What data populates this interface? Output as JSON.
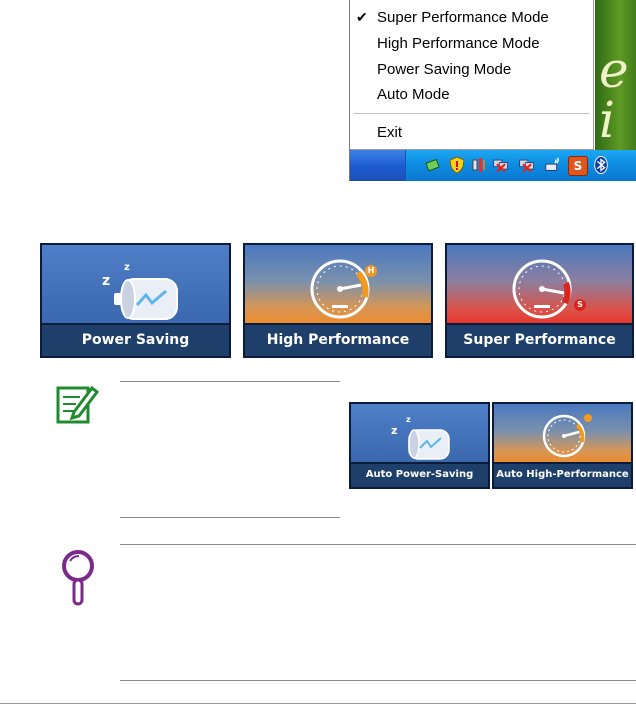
{
  "context_menu": {
    "items": [
      {
        "label": "Super Performance Mode",
        "checked": true
      },
      {
        "label": "High Performance Mode",
        "checked": false
      },
      {
        "label": "Power Saving Mode",
        "checked": false
      },
      {
        "label": "Auto Mode",
        "checked": false
      }
    ],
    "exit_label": "Exit",
    "check_glyph": "✔"
  },
  "tray_icons": [
    "network-icon",
    "security-shield-icon",
    "speaker-icon",
    "network-disconnected-icon",
    "network-disconnected-icon",
    "wireless-icon",
    "super-hybrid-engine-icon",
    "bluetooth-icon"
  ],
  "tray_badge": "S",
  "modes": [
    {
      "caption": "Power Saving",
      "icon": "battery-sleep-icon"
    },
    {
      "caption": "High Performance",
      "icon": "speedometer-icon",
      "badge": "H"
    },
    {
      "caption": "Super Performance",
      "icon": "speedometer-icon",
      "badge": "S"
    }
  ],
  "auto_modes": [
    {
      "caption": "Auto Power-Saving",
      "icon": "battery-sleep-icon"
    },
    {
      "caption": "Auto High-Performance",
      "icon": "speedometer-icon"
    }
  ],
  "sleep_glyph": "z",
  "colors": {
    "note_green": "#1f8a2e",
    "tip_purple": "#7a2a88",
    "caption_blue": "#1d3f6a",
    "high_accent": "#f39a1e",
    "super_accent": "#d8261c"
  }
}
